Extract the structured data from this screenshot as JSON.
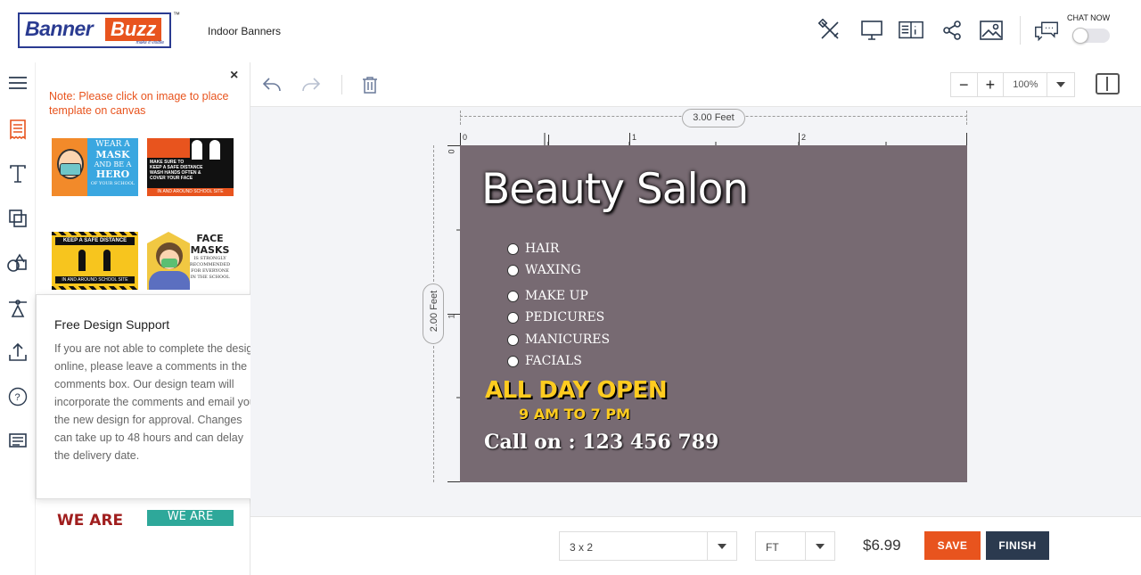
{
  "header": {
    "logo": {
      "word1": "Banner",
      "word2": "Buzz",
      "tagline": "make it visible",
      "tm": "™"
    },
    "breadcrumb": "Indoor Banners",
    "icons": [
      "tools-icon",
      "desktop-preview-icon",
      "book-info-icon",
      "share-icon",
      "image-icon",
      "chat-icon"
    ],
    "chat_label": "CHAT NOW",
    "chat_toggle_on": false
  },
  "rail": {
    "items": [
      "menu-icon",
      "templates-icon",
      "text-icon",
      "layers-icon",
      "shapes-icon",
      "clipart-icon",
      "upload-icon",
      "help-icon",
      "comments-icon"
    ]
  },
  "panel": {
    "close": "×",
    "note": "Note: Please click on image to place template on canvas",
    "thumbs": {
      "t1": {
        "line1": "WEAR A",
        "line2": "MASK",
        "line3": "AND BE A",
        "line4": "HERO",
        "line5": "OF YOUR SCHOOL"
      },
      "t2": {
        "line1": "MAKE SURE TO",
        "line2": "KEEP A SAFE DISTANCE",
        "line3": "WASH HANDS OFTEN &",
        "line4": "COVER YOUR FACE",
        "line5": "IN AND AROUND SCHOOL SITE"
      },
      "t3": {
        "line1": "KEEP A SAFE DISTANCE",
        "line2": "IN AND AROUND SCHOOL SITE"
      },
      "t4": {
        "line1": "FACE",
        "line2": "MASKS",
        "line3": "IS STRONGLY",
        "line4": "RECOMMENDED",
        "line5": "FOR EVERYONE",
        "line6": "IN THE SCHOOL"
      },
      "t5": {
        "line1": "WE ARE"
      },
      "t6": {
        "line1": "WE ARE"
      }
    }
  },
  "popover": {
    "title": "Free Design Support",
    "close": "×",
    "body": "If you are not able to complete the design online, please leave a comments in the comments box. Our design team will incorporate the comments and email you the new design for approval. Changes can take up to 48 hours and can delay the delivery date."
  },
  "toolbar": {
    "zoom_value": "100%",
    "zoom_minus": "−",
    "zoom_plus": "+"
  },
  "canvas": {
    "width_label": "3.00 Feet",
    "height_label": "2.00 Feet",
    "ruler_h": [
      "0",
      "1",
      "2"
    ],
    "ruler_v": [
      "0",
      "1"
    ],
    "background": "#776a72",
    "title": "Beauty Salon",
    "services": [
      "HAIR",
      "WAXING",
      "MAKE UP",
      "PEDICURES",
      "MANICURES",
      "FACIALS"
    ],
    "open_text": "ALL DAY OPEN",
    "hours_text": "9 AM TO 7 PM",
    "call_text": "Call on : 123 456 789"
  },
  "bottombar": {
    "size_value": "3 x 2",
    "unit_value": "FT",
    "price": "$6.99",
    "save_label": "SAVE",
    "finish_label": "FINISH"
  },
  "colors": {
    "accent": "#e8541e",
    "brand_blue": "#2a3b91",
    "finish_button": "#2b3a4f",
    "highlight_yellow": "#ffcc1f"
  }
}
